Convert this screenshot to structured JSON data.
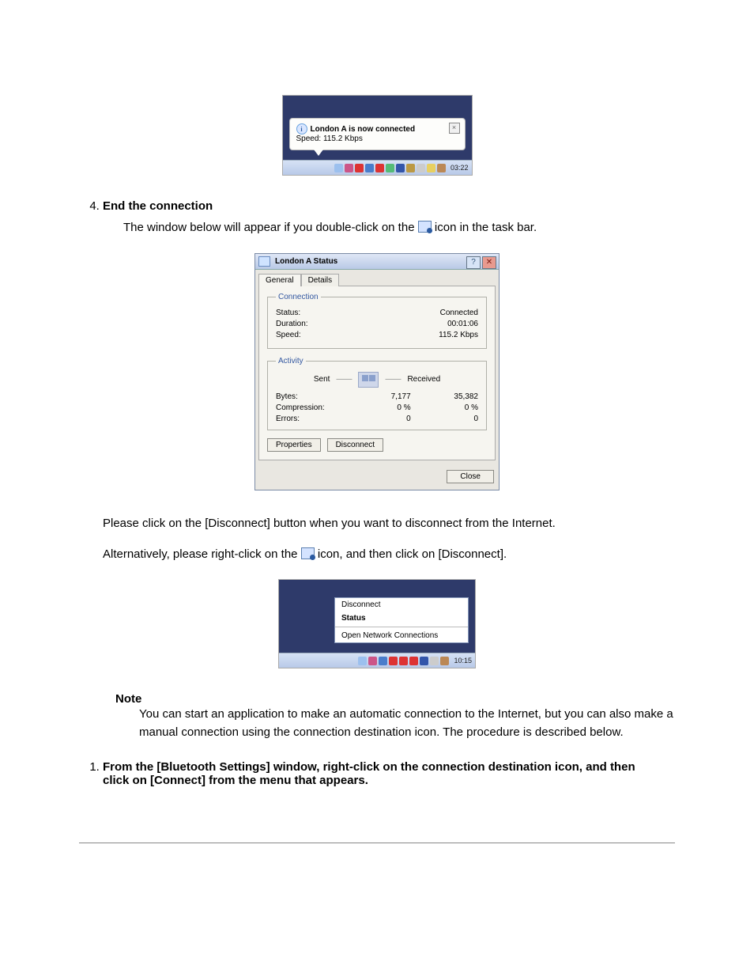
{
  "fig1": {
    "balloon_title": "London A is now connected",
    "balloon_speed": "Speed: 115.2 Kbps",
    "taskbar_time": "03:22"
  },
  "step4": {
    "heading": "End the connection",
    "body_before": "The window below will appear if you double-click on the",
    "body_after": "icon in the task bar."
  },
  "status_dialog": {
    "title": "London A Status",
    "tab_general": "General",
    "tab_details": "Details",
    "group_connection": "Connection",
    "status_label": "Status:",
    "status_value": "Connected",
    "duration_label": "Duration:",
    "duration_value": "00:01:06",
    "speed_label": "Speed:",
    "speed_value": "115.2 Kbps",
    "group_activity": "Activity",
    "sent_label": "Sent",
    "received_label": "Received",
    "bytes_label": "Bytes:",
    "bytes_sent": "7,177",
    "bytes_recv": "35,382",
    "compression_label": "Compression:",
    "compression_sent": "0 %",
    "compression_recv": "0 %",
    "errors_label": "Errors:",
    "errors_sent": "0",
    "errors_recv": "0",
    "btn_properties": "Properties",
    "btn_disconnect": "Disconnect",
    "btn_close": "Close"
  },
  "para_after_dialog": "Please click on the [Disconnect] button when you want to disconnect from the Internet.",
  "para_alt_before": "Alternatively, please right-click on the",
  "para_alt_after": "icon, and then click on [Disconnect].",
  "context_menu": {
    "item_disconnect": "Disconnect",
    "item_status": "Status",
    "item_open": "Open Network Connections",
    "taskbar_time": "10:15"
  },
  "note": {
    "label": "Note",
    "body": "You can start an application to make an automatic connection to the Internet, but you can also make a manual connection using the connection destination icon. The procedure is described below."
  },
  "step1b": {
    "heading": "From the [Bluetooth Settings] window, right-click on the connection destination icon, and then click on [Connect] from the menu that appears"
  }
}
